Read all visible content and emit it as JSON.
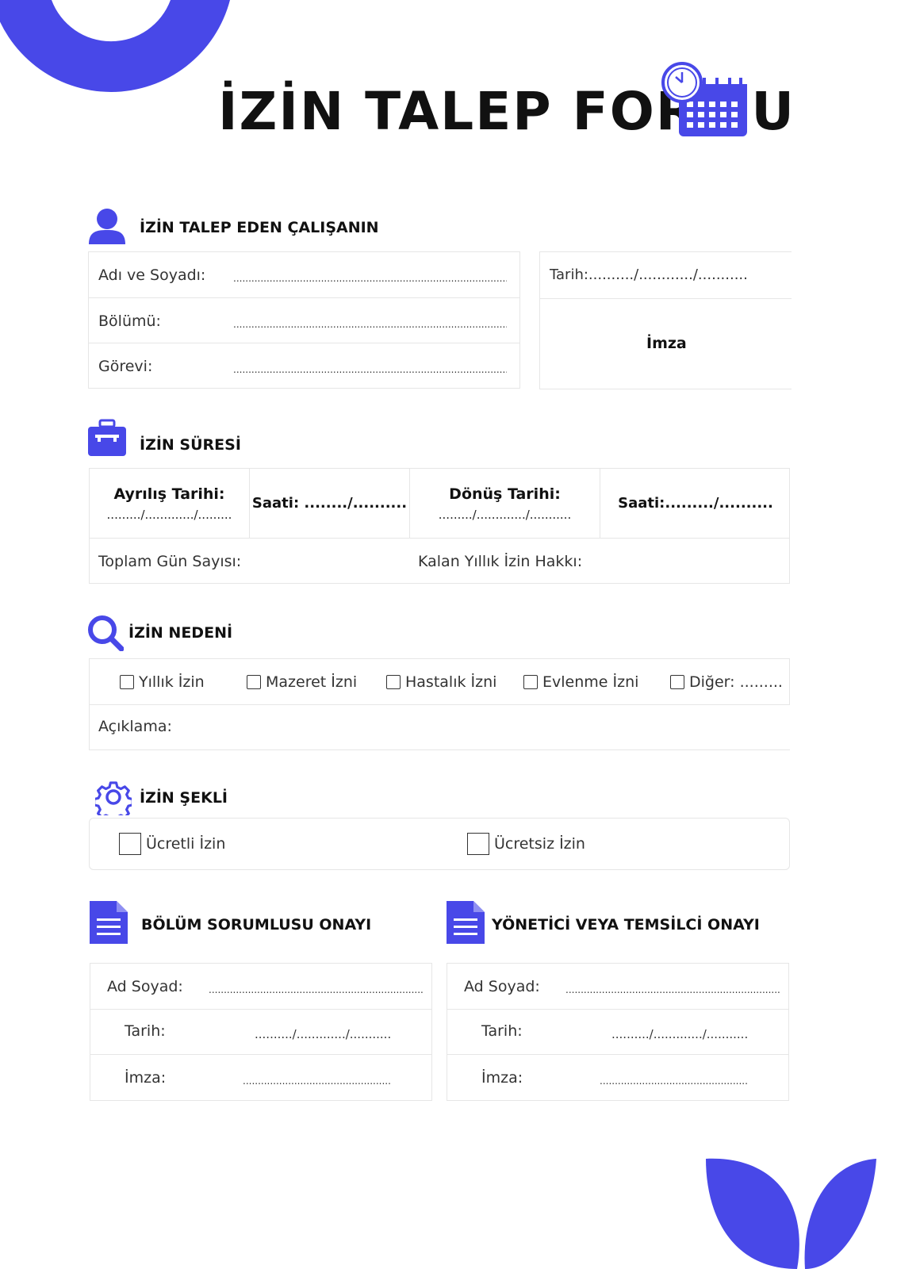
{
  "title": "İZİN TALEP FORMU",
  "colors": {
    "accent": "#4848e8",
    "text": "#111111",
    "border": "#e6e6e6"
  },
  "employee": {
    "heading": "İZİN TALEP EDEN ÇALIŞANIN",
    "name_label": "Adı ve Soyadı:",
    "dept_label": "Bölümü:",
    "role_label": "Görevi:",
    "date_label": "Tarih:........../............/...........",
    "signature_label": "İmza",
    "dots": "..........................................................................................................."
  },
  "duration": {
    "heading": "İZİN SÜRESİ",
    "departure_label": "Ayrılış Tarihi:",
    "departure_dots": "........./............./.........",
    "time1": "Saati: ......../..........",
    "return_label": "Dönüş Tarihi:",
    "return_dots": "........./............./...........",
    "time2": "Saati:........./..........",
    "total_days": "Toplam Gün Sayısı:",
    "remaining": "Kalan Yıllık İzin Hakkı:"
  },
  "reason": {
    "heading": "İZİN NEDENİ",
    "options": [
      "Yıllık İzin",
      "Mazeret İzni",
      "Hastalık İzni",
      "Evlenme İzni",
      "Diğer: ........."
    ],
    "explanation": "Açıklama:"
  },
  "type": {
    "heading": "İZİN ŞEKLİ",
    "paid": "Ücretli İzin",
    "unpaid": "Ücretsiz İzin"
  },
  "dept_approval": {
    "heading": "BÖLÜM SORUMLUSU ONAYI",
    "name_label": "Ad Soyad:",
    "date_label": "Tarih:",
    "sign_label": "İmza:",
    "name_dots": "...........................................................................................",
    "date_dots": "........../............./...........",
    "sign_dots": "..................................................................."
  },
  "mgr_approval": {
    "heading": "YÖNETİCİ VEYA TEMSİLCİ ONAYI",
    "name_label": "Ad Soyad:",
    "date_label": "Tarih:",
    "sign_label": "İmza:",
    "name_dots": "...........................................................................................",
    "date_dots": "........../............./...........",
    "sign_dots": "..................................................................."
  }
}
